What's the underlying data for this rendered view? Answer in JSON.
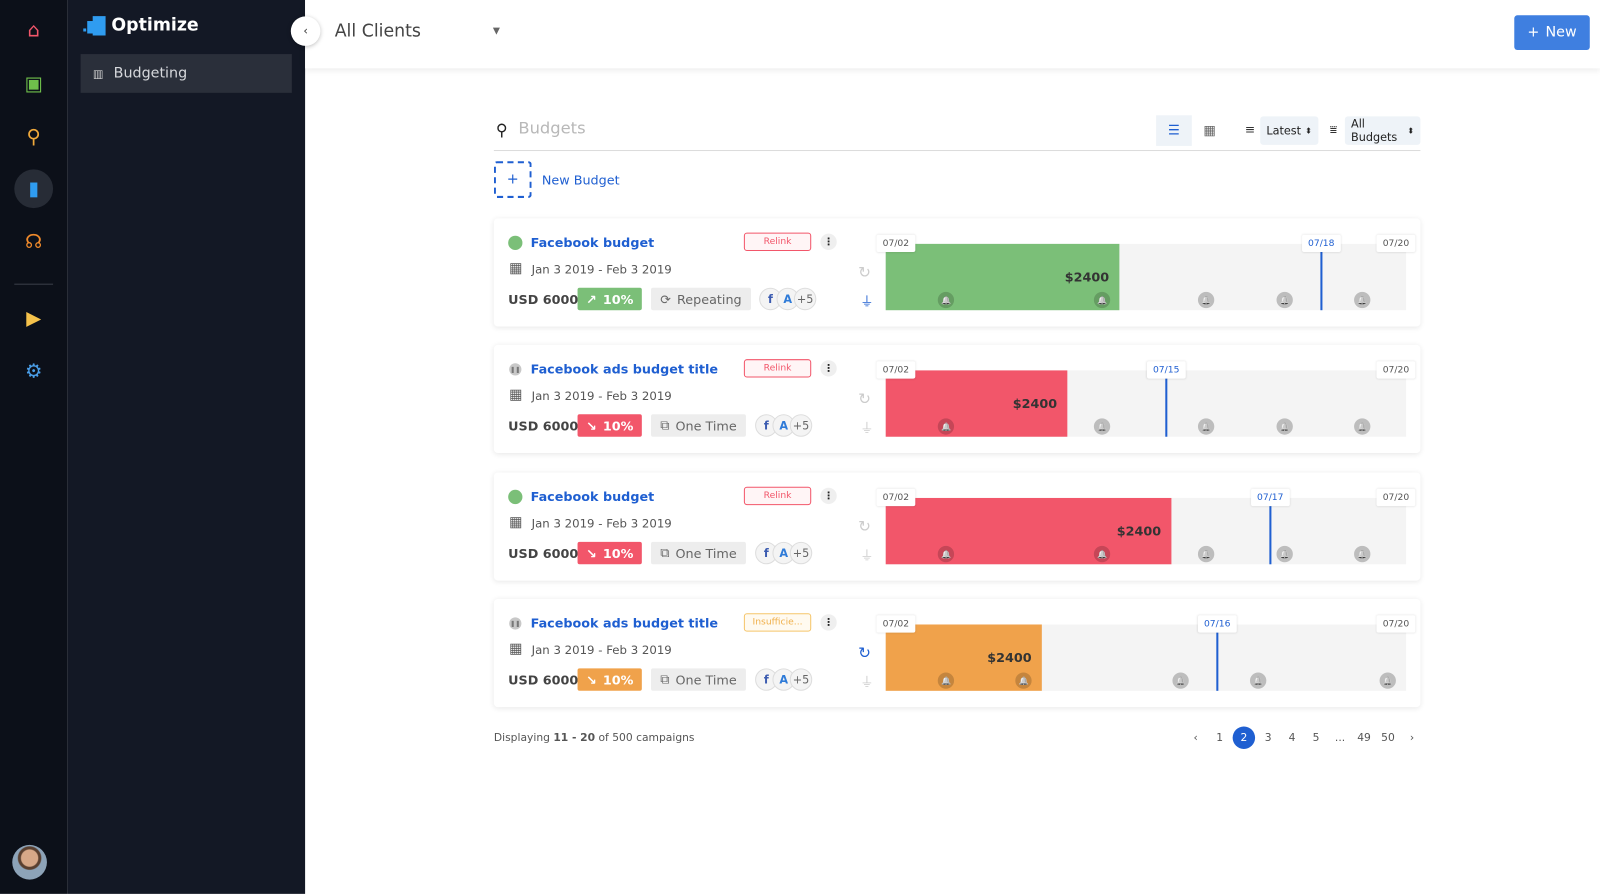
{
  "colors": {
    "accent": "#1f5fd1",
    "green": "#7bbf78",
    "red": "#f2566a",
    "orange": "#f0a24b",
    "sidebar": "#131825",
    "rail": "#0c1019"
  },
  "rail": {
    "items": [
      {
        "icon": "home-icon",
        "glyph": "⌂",
        "color": "#f2566a"
      },
      {
        "icon": "presentation-icon",
        "glyph": "▣",
        "color": "#6fc04b"
      },
      {
        "icon": "analytics-search-icon",
        "glyph": "⚲",
        "color": "#f0a93b"
      },
      {
        "icon": "optimize-icon",
        "glyph": "▮",
        "color": "#2f9cf0",
        "active": true
      },
      {
        "icon": "audience-icon",
        "glyph": "☊",
        "color": "#f08a2b"
      },
      {
        "icon": "plugin-icon",
        "glyph": "▶",
        "color": "#f5c24b"
      },
      {
        "icon": "settings-icon",
        "glyph": "⚙",
        "color": "#4a9ee8"
      }
    ]
  },
  "sidebar": {
    "title": "Optimize",
    "items": [
      {
        "label": "Budgeting",
        "active": true
      }
    ]
  },
  "header": {
    "client": "All Clients",
    "new_label": "New"
  },
  "toolbar": {
    "search_placeholder": "Budgets",
    "sort": "Latest",
    "filter": "All Budgets"
  },
  "new_budget_label": "New Budget",
  "cards": [
    {
      "title": "Facebook budget",
      "status": "active",
      "badge": "Relink",
      "badge_kind": "error",
      "dates": "Jan 3 2019 - Feb 3 2019",
      "amount": "USD 6000",
      "pct": "10%",
      "trend": "up",
      "pct_color": "#7bbf78",
      "type": "Repeating",
      "type_icon": "repeat-icon",
      "platforms": [
        "f",
        "A",
        "+5"
      ],
      "history_active": false,
      "plug_active": true,
      "start": "07/02",
      "end": "07/20",
      "today": "07/18",
      "spent": "$2400",
      "spent_fraction": 0.449,
      "fill_color": "#7bbf78"
    },
    {
      "title": "Facebook ads budget title",
      "status": "paused",
      "badge": "Relink",
      "badge_kind": "error",
      "dates": "Jan 3 2019 - Feb 3 2019",
      "amount": "USD 6000",
      "pct": "10%",
      "trend": "down",
      "pct_color": "#f2566a",
      "type": "One Time",
      "type_icon": "one-time-icon",
      "platforms": [
        "f",
        "A",
        "+5"
      ],
      "history_active": false,
      "plug_active": false,
      "start": "07/02",
      "end": "07/20",
      "today": "07/15",
      "spent": "$2400",
      "spent_fraction": 0.349,
      "fill_color": "#f2566a"
    },
    {
      "title": "Facebook budget",
      "status": "active",
      "badge": "Relink",
      "badge_kind": "error",
      "dates": "Jan 3 2019 - Feb 3 2019",
      "amount": "USD 6000",
      "pct": "10%",
      "trend": "down",
      "pct_color": "#f2566a",
      "type": "One Time",
      "type_icon": "one-time-icon",
      "platforms": [
        "f",
        "A",
        "+5"
      ],
      "history_active": false,
      "plug_active": false,
      "start": "07/02",
      "end": "07/20",
      "today": "07/17",
      "spent": "$2400",
      "spent_fraction": 0.549,
      "fill_color": "#f2566a"
    },
    {
      "title": "Facebook ads budget title",
      "status": "paused",
      "badge": "Insufficie...",
      "badge_kind": "warning",
      "dates": "Jan 3 2019 - Feb 3 2019",
      "amount": "USD 6000",
      "pct": "10%",
      "trend": "down",
      "pct_color": "#f0a24b",
      "type": "One Time",
      "type_icon": "one-time-icon",
      "platforms": [
        "f",
        "A",
        "+5"
      ],
      "history_active": true,
      "plug_active": false,
      "start": "07/02",
      "end": "07/20",
      "today": "07/16",
      "spent": "$2400",
      "spent_fraction": 0.3,
      "fill_color": "#f0a24b"
    }
  ],
  "footer": {
    "prefix": "Displaying ",
    "range": "11 - 20",
    "suffix": " of 500 campaigns"
  },
  "pagination": {
    "pages": [
      "1",
      "2",
      "3",
      "4",
      "5",
      "...",
      "49",
      "50"
    ],
    "current": "2"
  }
}
